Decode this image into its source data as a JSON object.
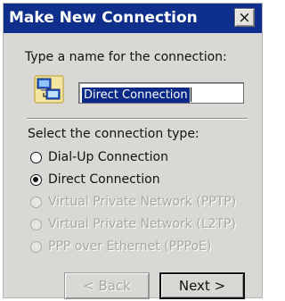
{
  "window": {
    "title": "Make New Connection",
    "close_glyph": "×"
  },
  "name_section": {
    "label": "Type a name for the connection:",
    "icon": "network-connection-icon",
    "input_value": "Direct Connection"
  },
  "type_section": {
    "label": "Select the connection type:",
    "options": [
      {
        "label": "Dial-Up Connection",
        "selected": false,
        "enabled": true
      },
      {
        "label": "Direct Connection",
        "selected": true,
        "enabled": true
      },
      {
        "label": "Virtual Private Network (PPTP)",
        "selected": false,
        "enabled": false
      },
      {
        "label": "Virtual Private Network (L2TP)",
        "selected": false,
        "enabled": false
      },
      {
        "label": "PPP over Ethernet (PPPoE)",
        "selected": false,
        "enabled": false
      }
    ]
  },
  "buttons": {
    "back_label": "< Back",
    "back_enabled": false,
    "next_label": "Next >"
  },
  "colors": {
    "titlebar": "#0f2f8c",
    "dialog_bg": "#d9d8d4",
    "selection": "#0a2a8a",
    "disabled_text": "#a8a7a3"
  }
}
